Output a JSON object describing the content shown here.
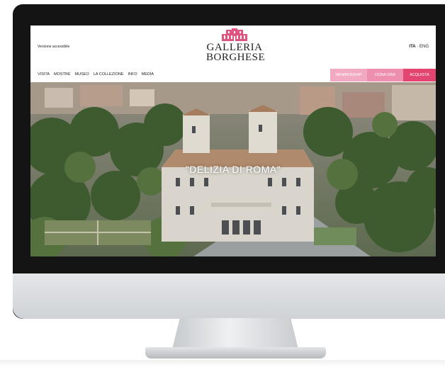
{
  "site": {
    "accessible_link": "Versione accessibile",
    "logo_line1": "GALLERIA",
    "logo_line2": "BORGHESE",
    "lang_ita": "ITA",
    "lang_sep": " · ",
    "lang_eng": "ENG"
  },
  "nav": {
    "items": [
      "VISITA",
      "MOSTRE",
      "MUSEO",
      "LA COLLEZIONE",
      "INFO",
      "MEDIA"
    ]
  },
  "actions": {
    "membership": "MEMBERSHIP",
    "dona": "DONA ORA",
    "acquista": "ACQUISTA"
  },
  "hero": {
    "title": "\"DELIZIA DI ROMA\""
  },
  "colors": {
    "brand_pink": "#e2456f",
    "light_pink": "#f2a9c2",
    "mid_pink": "#ef8fb0",
    "logo_pink": "#e0557f"
  }
}
